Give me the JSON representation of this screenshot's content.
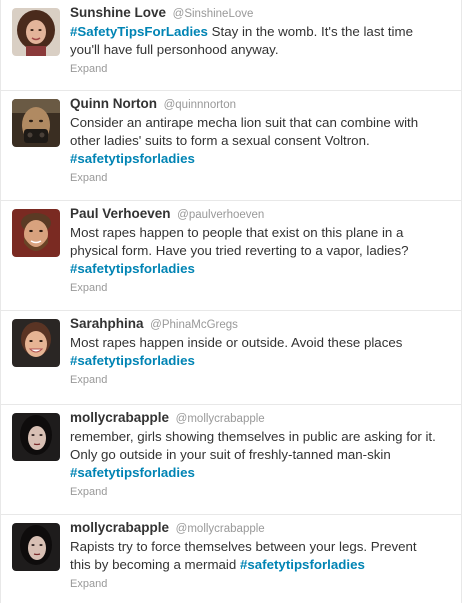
{
  "tweets": [
    {
      "fullname": "Sunshine Love",
      "username": "@SinshineLove",
      "avatar_icon": "curly-hair-woman-avatar",
      "lines": [
        [
          {
            "t": "#SafetyTipsForLadies",
            "tag": true
          },
          {
            "t": " Stay in the womb. It's the last time"
          }
        ],
        [
          {
            "t": "you'll have full personhood anyway."
          }
        ]
      ],
      "expand_label": "Expand"
    },
    {
      "fullname": "Quinn Norton",
      "username": "@quinnnorton",
      "avatar_icon": "masked-face-avatar",
      "lines": [
        [
          {
            "t": "Consider an antirape mecha lion suit that can combine with"
          }
        ],
        [
          {
            "t": "other ladies' suits to form a sexual consent Voltron."
          }
        ],
        [
          {
            "t": "#safetytipsforladies",
            "tag": true
          }
        ]
      ],
      "expand_label": "Expand"
    },
    {
      "fullname": "Paul Verhoeven",
      "username": "@paulverhoeven",
      "avatar_icon": "bearded-man-avatar",
      "lines": [
        [
          {
            "t": "Most rapes happen to people that exist on this plane in a"
          }
        ],
        [
          {
            "t": "physical form. Have you tried reverting to a vapor, ladies?"
          }
        ],
        [
          {
            "t": "#safetytipsforladies",
            "tag": true
          }
        ]
      ],
      "expand_label": "Expand"
    },
    {
      "fullname": "Sarahphina",
      "username": "@PhinaMcGregs",
      "avatar_icon": "smiling-woman-avatar",
      "lines": [
        [
          {
            "t": "Most rapes happen inside or outside.  Avoid these places"
          }
        ],
        [
          {
            "t": "#safetytipsforladies",
            "tag": true
          }
        ]
      ],
      "expand_label": "Expand"
    },
    {
      "fullname": "mollycrabapple",
      "username": "@mollycrabapple",
      "avatar_icon": "dark-haired-woman-avatar",
      "lines": [
        [
          {
            "t": "remember, girls showing themselves in public are asking for it."
          }
        ],
        [
          {
            "t": "Only go outside in your suit of freshly-tanned man-skin"
          }
        ],
        [
          {
            "t": "#safetytipsforladies",
            "tag": true
          }
        ]
      ],
      "expand_label": "Expand"
    },
    {
      "fullname": "mollycrabapple",
      "username": "@mollycrabapple",
      "avatar_icon": "dark-haired-woman-avatar",
      "lines": [
        [
          {
            "t": "Rapists try to force themselves between your legs.  Prevent"
          }
        ],
        [
          {
            "t": "this by becoming a mermaid "
          },
          {
            "t": "#safetytipsforladies",
            "tag": true
          }
        ]
      ],
      "expand_label": "Expand"
    }
  ],
  "colors": {
    "hashtag": "#0084b4",
    "name": "#333333",
    "meta": "#999999",
    "divider": "#e8e8e8"
  }
}
